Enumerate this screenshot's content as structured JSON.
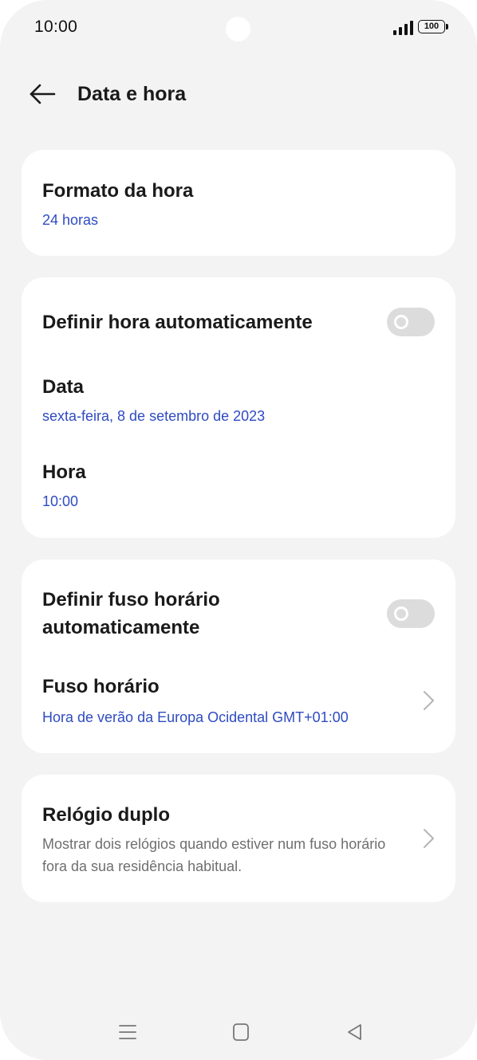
{
  "status_bar": {
    "time": "10:00",
    "battery": "100",
    "icons": [
      "signal-icon",
      "battery-icon"
    ]
  },
  "header": {
    "back_icon": "arrow-left-icon",
    "title": "Data e hora"
  },
  "time_format": {
    "title": "Formato da hora",
    "value": "24 horas"
  },
  "date_time": {
    "auto_time_label": "Definir hora automaticamente",
    "auto_time_enabled": false,
    "date_title": "Data",
    "date_value": "sexta-feira, 8 de setembro de 2023",
    "time_title": "Hora",
    "time_value": "10:00"
  },
  "timezone": {
    "auto_tz_label_line1": "Definir fuso horário",
    "auto_tz_label_line2": "automaticamente",
    "auto_tz_enabled": false,
    "tz_title": "Fuso horário",
    "tz_value": "Hora de verão da Europa Ocidental GMT+01:00"
  },
  "dual_clock": {
    "title": "Relógio duplo",
    "description": "Mostrar dois relógios quando estiver num fuso horário fora da sua residência habitual."
  },
  "nav_bar": {
    "icons": [
      "menu-icon",
      "home-icon",
      "back-triangle-icon"
    ]
  },
  "colors": {
    "accent": "#2f4bc2",
    "background": "#f3f3f3",
    "card": "#ffffff",
    "toggle_off": "#dcdcdc"
  }
}
